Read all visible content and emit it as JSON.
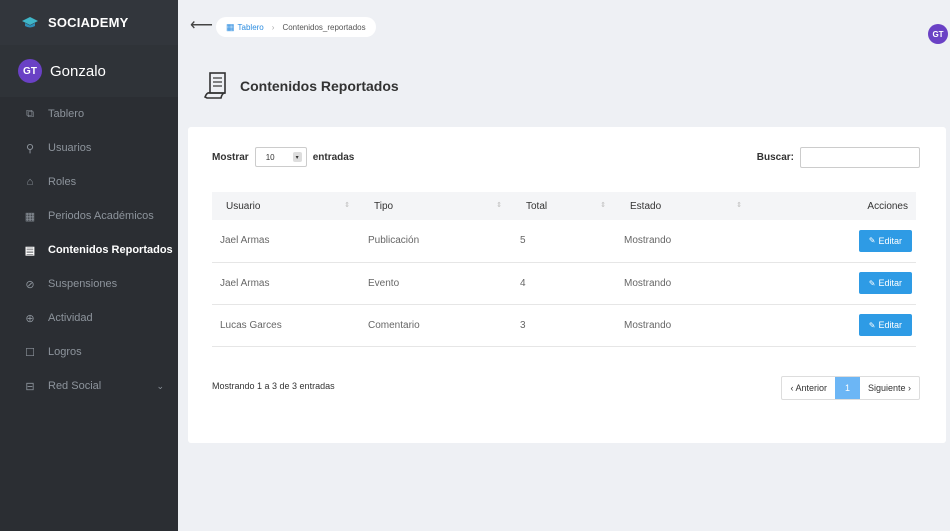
{
  "brand": {
    "name": "SOCIADEMY"
  },
  "user": {
    "initials": "GT",
    "name": "Gonzalo"
  },
  "sidebar": {
    "items": [
      {
        "icon": "⧉",
        "label": "Tablero"
      },
      {
        "icon": "⚲",
        "label": "Usuarios"
      },
      {
        "icon": "⌂",
        "label": "Roles"
      },
      {
        "icon": "▦",
        "label": "Periodos Académicos"
      },
      {
        "icon": "▤",
        "label": "Contenidos Reportados"
      },
      {
        "icon": "⊘",
        "label": "Suspensiones"
      },
      {
        "icon": "⊕",
        "label": "Actividad"
      },
      {
        "icon": "☐",
        "label": "Logros"
      },
      {
        "icon": "⊟",
        "label": "Red Social",
        "chevron": "⌄"
      }
    ]
  },
  "topbar": {
    "back_icon": "⟵",
    "breadcrumb": {
      "home": "Tablero",
      "home_icon": "▦",
      "separator": "›",
      "current": "Contenidos_reportados"
    },
    "avatar": "GT"
  },
  "page": {
    "title": "Contenidos Reportados"
  },
  "table_controls": {
    "show_label": "Mostrar",
    "entries_value": "10",
    "entries_label": "entradas",
    "search_label": "Buscar:",
    "search_placeholder": ""
  },
  "table": {
    "headers": [
      "Usuario",
      "Tipo",
      "Total",
      "Estado",
      "Acciones"
    ],
    "sort_icon": "⇕",
    "rows": [
      {
        "usuario": "Jael Armas",
        "tipo": "Publicación",
        "total": "5",
        "estado": "Mostrando",
        "action": "Editar"
      },
      {
        "usuario": "Jael Armas",
        "tipo": "Evento",
        "total": "4",
        "estado": "Mostrando",
        "action": "Editar"
      },
      {
        "usuario": "Lucas Garces",
        "tipo": "Comentario",
        "total": "3",
        "estado": "Mostrando",
        "action": "Editar"
      }
    ]
  },
  "footer": {
    "info": "Mostrando 1 a 3 de 3 entradas",
    "prev": "‹ Anterior",
    "page": "1",
    "next": "Siguiente ›"
  },
  "colors": {
    "accent": "#2e9be5",
    "sidebar": "#2b2e33",
    "avatar": "#6a41c5"
  }
}
